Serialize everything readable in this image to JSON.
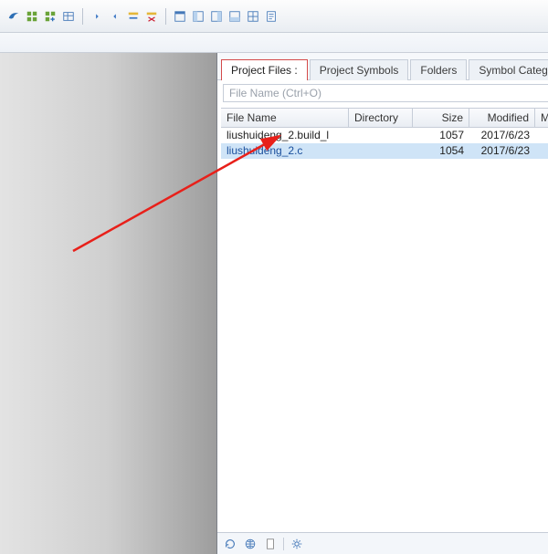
{
  "toolbar": {
    "icons": [
      "bird",
      "grid",
      "grid-plus",
      "table-icon",
      "bar-left",
      "bar-right",
      "row-up",
      "row-delete",
      "win1",
      "win2",
      "win3",
      "win4",
      "win-grid",
      "note-icon"
    ]
  },
  "tabs": {
    "items": [
      {
        "label": "Project Files :",
        "active": true
      },
      {
        "label": "Project Symbols",
        "active": false
      },
      {
        "label": "Folders",
        "active": false
      },
      {
        "label": "Symbol Categories",
        "active": false
      }
    ],
    "close_label": "×"
  },
  "filter": {
    "placeholder": "File Name (Ctrl+O)"
  },
  "columns": [
    "File Name",
    "Directory",
    "Size",
    "Modified",
    "Metr"
  ],
  "rows": [
    {
      "name": "liushuideng_2.build_l",
      "dir": "",
      "size": "1057",
      "modified": "2017/6/23",
      "selected": false
    },
    {
      "name": "liushuideng_2.c",
      "dir": "",
      "size": "1054",
      "modified": "2017/6/23",
      "selected": true
    }
  ],
  "status": {
    "icons": [
      "refresh-icon",
      "globe-icon",
      "page-icon",
      "sep",
      "gear-icon"
    ]
  }
}
